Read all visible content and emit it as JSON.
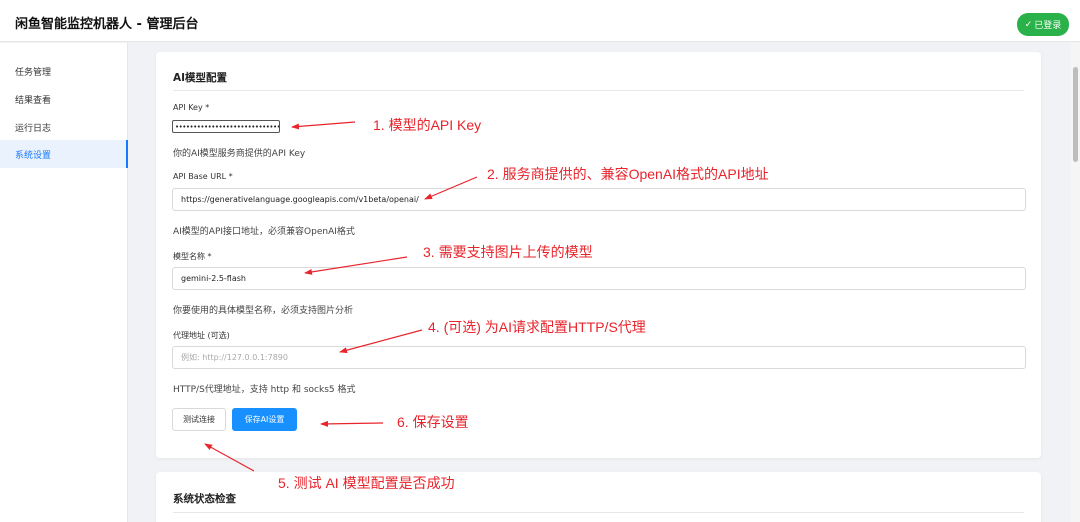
{
  "header": {
    "title": "闲鱼智能监控机器人 - 管理后台",
    "login_status": "已登录",
    "login_icon": "check-icon"
  },
  "sidebar": {
    "items": [
      {
        "label": "任务管理"
      },
      {
        "label": "结果查看"
      },
      {
        "label": "运行日志"
      },
      {
        "label": "系统设置",
        "active": true
      }
    ]
  },
  "ai_config": {
    "title": "AI模型配置",
    "api_key": {
      "label": "API Key *",
      "value": "••••••••••••••••••••••••••••••••••••••••",
      "help": "你的AI模型服务商提供的API Key"
    },
    "base_url": {
      "label": "API Base URL *",
      "value": "https://generativelanguage.googleapis.com/v1beta/openai/",
      "help": "AI模型的API接口地址，必须兼容OpenAI格式"
    },
    "model": {
      "label": "模型名称 *",
      "value": "gemini-2.5-flash",
      "help": "你要使用的具体模型名称，必须支持图片分析"
    },
    "proxy": {
      "label": "代理地址 (可选)",
      "placeholder": "例如: http://127.0.0.1:7890",
      "help": "HTTP/S代理地址，支持 http 和 socks5 格式"
    },
    "buttons": {
      "test": "测试连接",
      "save": "保存AI设置"
    }
  },
  "system_check": {
    "title": "系统状态检查"
  },
  "annotations": [
    "1. 模型的API Key",
    "2. 服务商提供的、兼容OpenAI格式的API地址",
    "3. 需要支持图片上传的模型",
    "4. (可选) 为AI请求配置HTTP/S代理",
    "5. 测试 AI 模型配置是否成功",
    "6. 保存设置"
  ],
  "colors": {
    "primary": "#1890ff",
    "success": "#2ab14a",
    "annotation": "#e8242c"
  }
}
